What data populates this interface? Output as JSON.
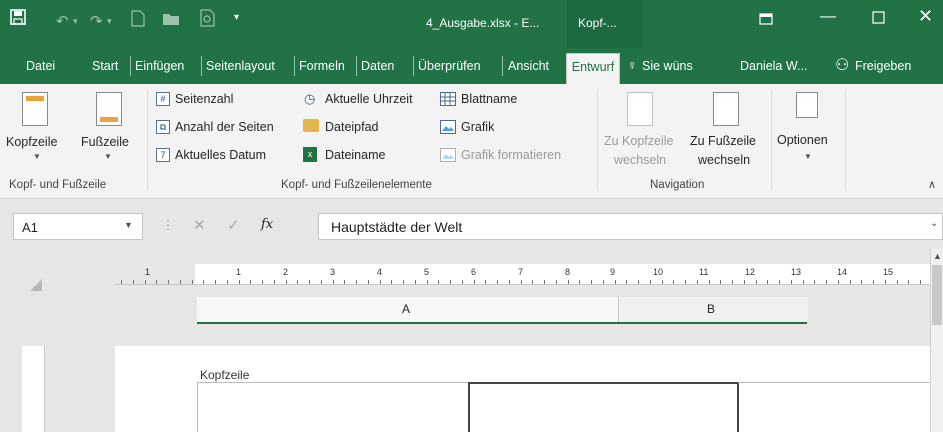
{
  "titlebar": {
    "doc_title": "4_Ausgabe.xlsx - E...",
    "contextual_title": "Kopf-...",
    "icons": [
      "save-icon",
      "undo-icon",
      "redo-icon",
      "new-icon",
      "open-icon",
      "print-preview-icon",
      "customize-icon",
      "ribbon-display-icon",
      "minimize-icon",
      "maximize-icon",
      "close-icon"
    ]
  },
  "tabs": [
    "Datei",
    "Start",
    "Einfügen",
    "Seitenlayout",
    "Formeln",
    "Daten",
    "Überprüfen",
    "Ansicht",
    "Entwurf"
  ],
  "tell_me": "Sie wüns",
  "user": "Daniela W...",
  "share": "Freigeben",
  "ribbon": {
    "header_button": "Kopfzeile",
    "footer_button": "Fußzeile",
    "group1_label": "Kopf- und Fußzeile",
    "page_number": "Seitenzahl",
    "page_count": "Anzahl der Seiten",
    "current_date": "Aktuelles Datum",
    "current_time": "Aktuelle Uhrzeit",
    "file_path": "Dateipfad",
    "file_name": "Dateiname",
    "sheet_name": "Blattname",
    "picture": "Grafik",
    "format_picture": "Grafik formatieren",
    "group2_label": "Kopf- und Fußzeilenelemente",
    "goto_header_1": "Zu Kopfzeile",
    "goto_header_2": "wechseln",
    "goto_footer_1": "Zu Fußzeile",
    "goto_footer_2": "wechseln",
    "group3_label": "Navigation",
    "options": "Optionen"
  },
  "formula_bar": {
    "name_box": "A1",
    "fx": "fx",
    "content": "Hauptstädte der Welt"
  },
  "ruler": [
    "1",
    "1",
    "2",
    "3",
    "4",
    "5",
    "6",
    "7",
    "8",
    "9",
    "10",
    "11",
    "12",
    "13",
    "14",
    "15"
  ],
  "columns": [
    "A",
    "B"
  ],
  "page": {
    "header_label": "Kopfzeile"
  },
  "colors": {
    "accent": "#217346",
    "ribbon_bg": "#f3f3f3"
  }
}
